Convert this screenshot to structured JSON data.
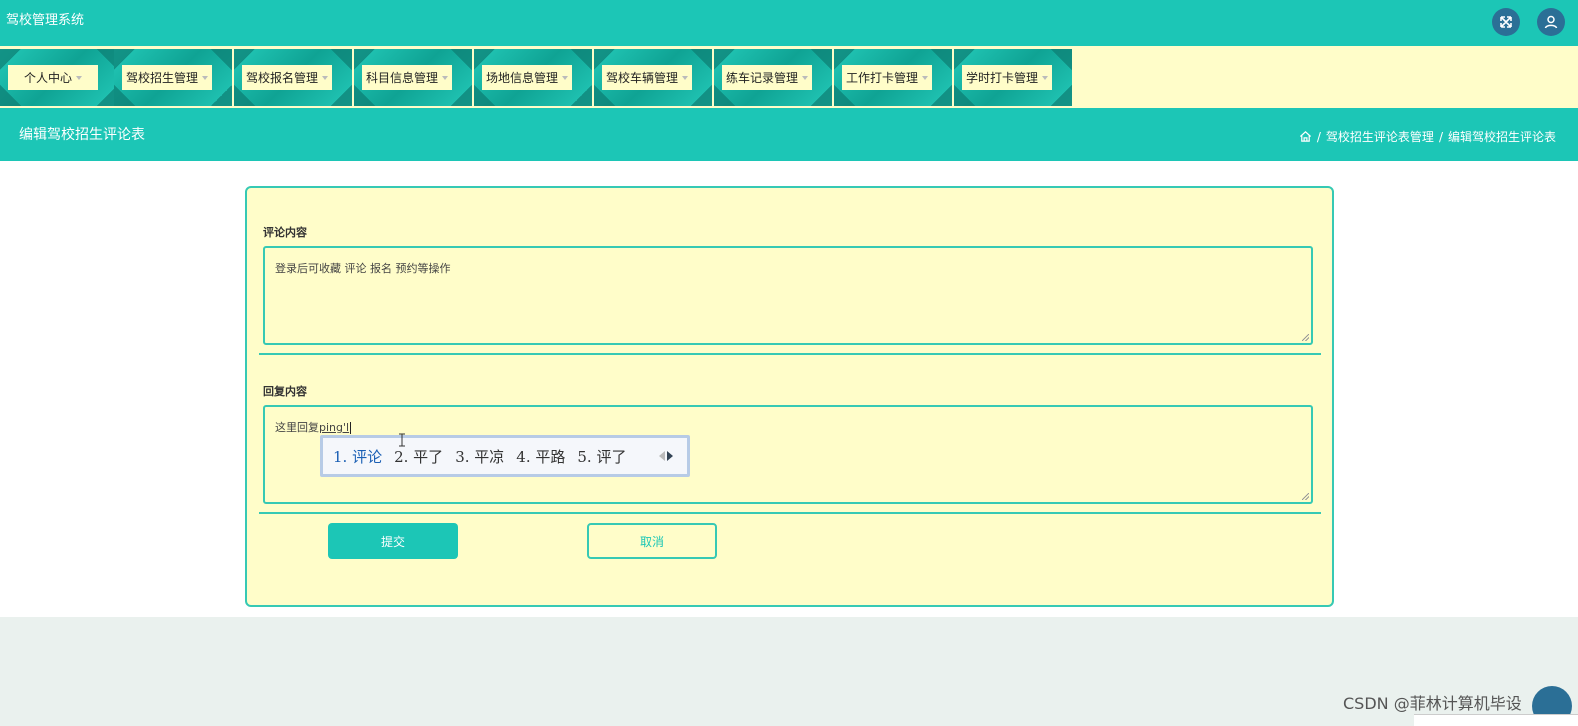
{
  "header": {
    "app_title": "驾校管理系统",
    "fullscreen_icon": "fullscreen-icon",
    "user_icon": "user-icon"
  },
  "menu": {
    "items": [
      {
        "label": "个人中心"
      },
      {
        "label": "驾校招生管理"
      },
      {
        "label": "驾校报名管理"
      },
      {
        "label": "科目信息管理"
      },
      {
        "label": "场地信息管理"
      },
      {
        "label": "驾校车辆管理"
      },
      {
        "label": "练车记录管理"
      },
      {
        "label": "工作打卡管理"
      },
      {
        "label": "学时打卡管理"
      }
    ]
  },
  "page": {
    "title": "编辑驾校招生评论表",
    "breadcrumb": {
      "home_icon": "home-icon",
      "separator": "/",
      "items": [
        "驾校招生评论表管理",
        "编辑驾校招生评论表"
      ]
    }
  },
  "form": {
    "comment_label": "评论内容",
    "comment_value": "登录后可收藏 评论 报名 预约等操作",
    "reply_label": "回复内容",
    "reply_prefix": "这里回复",
    "reply_pinyin": "ping'l",
    "submit_label": "提交",
    "cancel_label": "取消"
  },
  "ime": {
    "candidates": [
      "1. 评论",
      "2. 平了",
      "3. 平凉",
      "4. 平路",
      "5. 评了"
    ]
  },
  "watermark": "CSDN @菲林计算机毕设",
  "colors": {
    "primary": "#1cc6b6",
    "panel": "#fffdc9",
    "border": "#36c9b4",
    "dark_button": "#2b6f96"
  }
}
